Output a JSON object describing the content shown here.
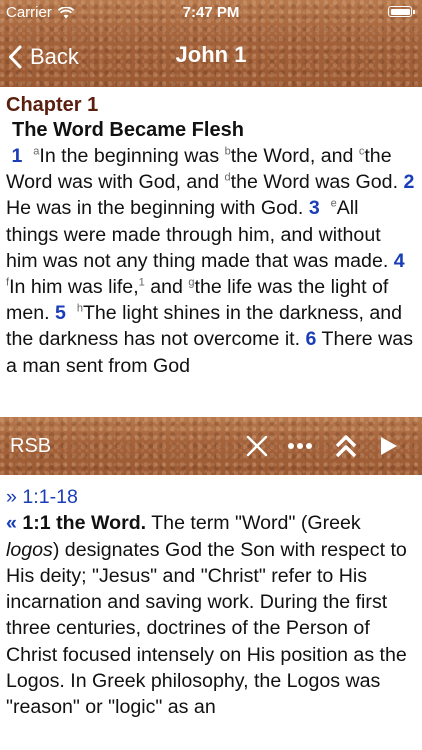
{
  "status_bar": {
    "carrier": "Carrier",
    "time": "7:47 PM",
    "icons": [
      "wifi-icon",
      "battery-icon"
    ]
  },
  "nav": {
    "back_label": "Back",
    "title": "John 1"
  },
  "scripture": {
    "chapter": "Chapter 1",
    "heading": "The Word Became Flesh",
    "verses": [
      {
        "num": "1",
        "segments": [
          {
            "fn": "a",
            "text": "In the beginning was "
          },
          {
            "fn": "b",
            "text": "the Word, and "
          },
          {
            "fn": "c",
            "text": "the Word was with God, and "
          },
          {
            "fn": "d",
            "text": "the Word was God."
          }
        ]
      },
      {
        "num": "2",
        "segments": [
          {
            "fn": "",
            "text": "He was in the beginning with God."
          }
        ]
      },
      {
        "num": "3",
        "segments": [
          {
            "fn": "e",
            "text": "All things were made through him, and without him was not any thing made that was made."
          }
        ]
      },
      {
        "num": "4",
        "segments": [
          {
            "fn": "f",
            "text": "In him was life,"
          },
          {
            "fn": "1",
            "text": " and "
          },
          {
            "fn": "g",
            "text": "the life was the light of men."
          }
        ]
      },
      {
        "num": "5",
        "segments": [
          {
            "fn": "h",
            "text": "The light shines in the darkness, and the darkness has not overcome it."
          }
        ]
      },
      {
        "num": "6",
        "segments": [
          {
            "fn": "i",
            "text": "There was a man sent from God"
          }
        ]
      }
    ]
  },
  "toolbar": {
    "label": "RSB",
    "buttons": [
      "close-icon",
      "more-icon",
      "collapse-up-icon",
      "play-icon"
    ]
  },
  "commentary": {
    "range_marker": "»",
    "range": "1:1-18",
    "back_marker": "«",
    "entry_title": "1:1 the Word.",
    "p1": " The term \"Word\" (Greek ",
    "term": "logos",
    "p2": ") designates God the Son with respect to His deity; \"Jesus\" and \"Christ\" refer to His incarnation and saving work. During the first three centuries, doctrines of the Person of Christ focused intensely on His position as the Logos. In Greek philosophy, the Logos was \"reason\" or \"logic\" as an"
  }
}
